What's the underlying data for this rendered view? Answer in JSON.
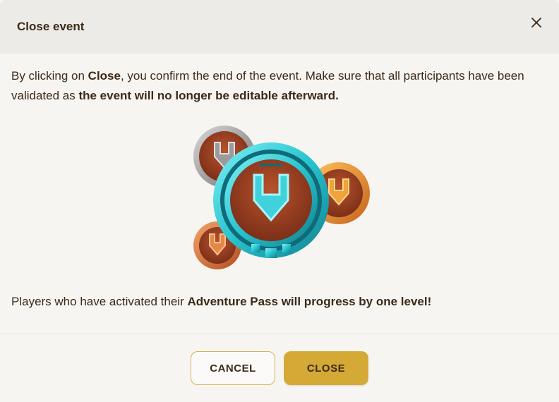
{
  "dialog": {
    "title": "Close event",
    "close_icon": "close-icon"
  },
  "intro": {
    "part1": "By clicking on ",
    "bold1": "Close",
    "part2": ", you confirm the end of the event. Make sure that all participants have been validated as ",
    "bold2": "the event will no longer be editable afterward."
  },
  "emblem": {
    "icon": "adventure-pass-badges-icon",
    "colors": {
      "main_ring": "#2fc4cf",
      "medal_center": "#9a3f22",
      "silver": "#8c8c8c",
      "gold": "#e9932a",
      "bronze": "#d8713a"
    }
  },
  "outro": {
    "part1": "Players who have activated their ",
    "bold1": "Adventure Pass will progress by one level!"
  },
  "buttons": {
    "cancel_label": "CANCEL",
    "close_label": "CLOSE"
  },
  "colors": {
    "header_bg": "#ecebe8",
    "body_bg": "#f7f5f2",
    "accent": "#d4a935",
    "text": "#3b2a17"
  }
}
